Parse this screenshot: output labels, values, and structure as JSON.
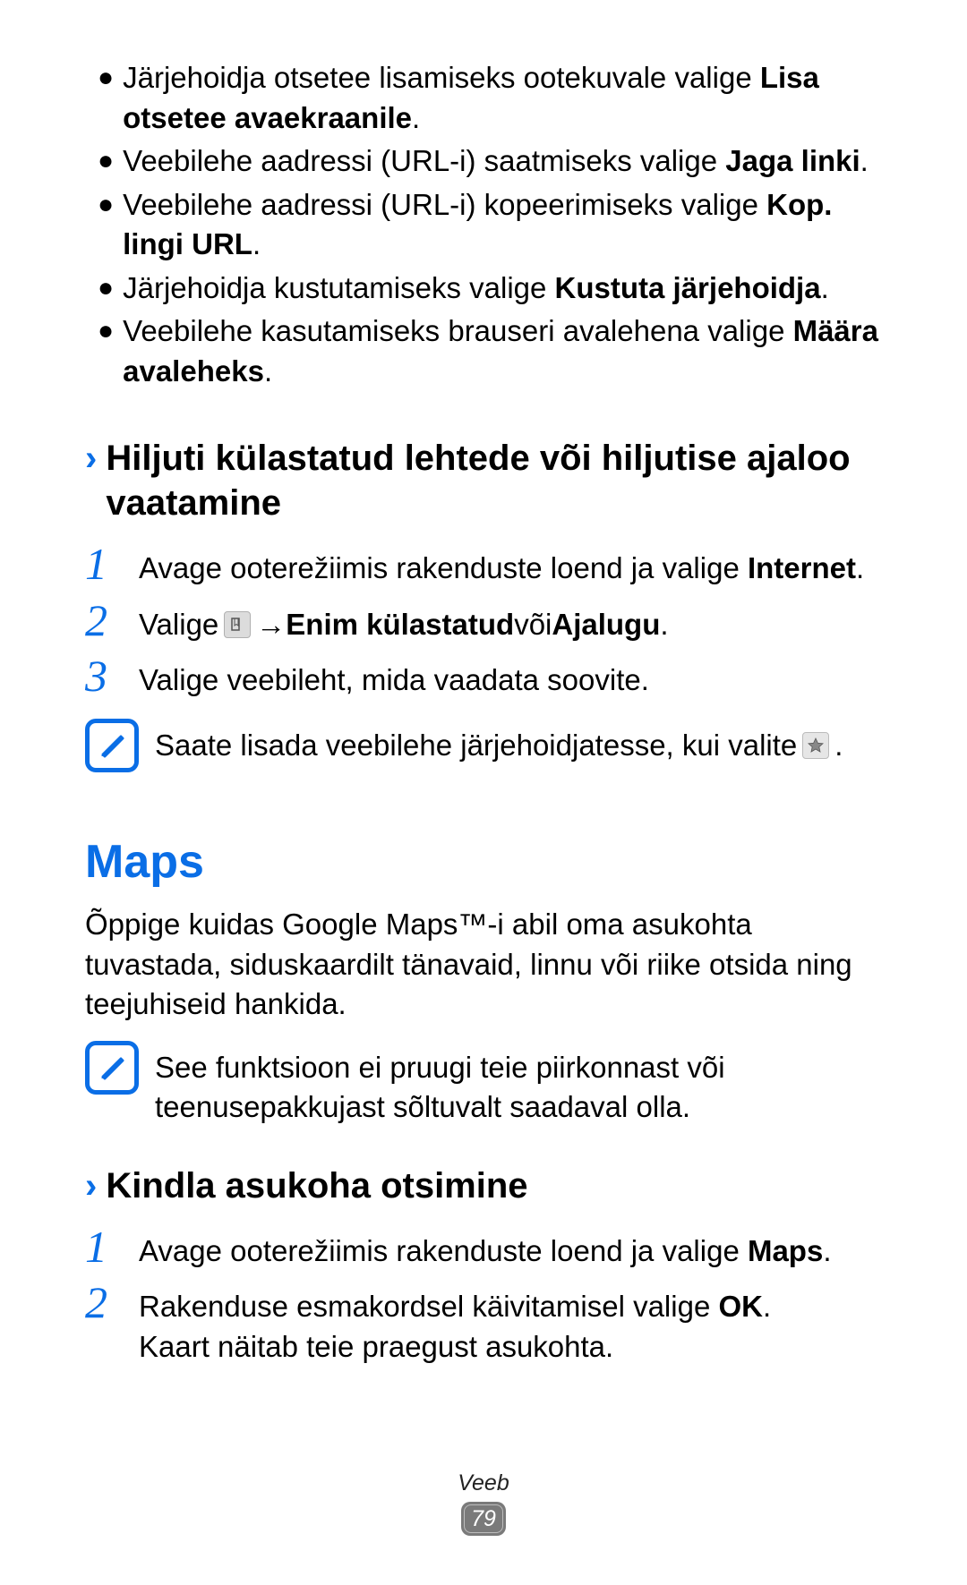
{
  "bullets": [
    {
      "pre": "Järjehoidja otsetee lisamiseks ootekuvale valige ",
      "bold": "Lisa otsetee avaekraanile",
      "post": "."
    },
    {
      "pre": "Veebilehe aadressi (URL-i) saatmiseks valige ",
      "bold": "Jaga linki",
      "post": "."
    },
    {
      "pre": "Veebilehe aadressi (URL-i) kopeerimiseks valige ",
      "bold": "Kop. lingi URL",
      "post": "."
    },
    {
      "pre": "Järjehoidja kustutamiseks valige ",
      "bold": "Kustuta järjehoidja",
      "post": "."
    },
    {
      "pre": "Veebilehe kasutamiseks brauseri avalehena valige ",
      "bold": "Määra avaleheks",
      "post": "."
    }
  ],
  "sub1": "Hiljuti külastatud lehtede või hiljutise ajaloo vaatamine",
  "steps1": {
    "s1_pre": "Avage ooterežiimis rakenduste loend ja valige ",
    "s1_bold": "Internet",
    "s1_post": ".",
    "s2_a": "Valige ",
    "s2_arrow": " → ",
    "s2_bold1": "Enim külastatud",
    "s2_mid": " või ",
    "s2_bold2": "Ajalugu",
    "s2_post": ".",
    "s3": "Valige veebileht, mida vaadata soovite."
  },
  "note1_pre": "Saate lisada veebilehe järjehoidjatesse, kui valite ",
  "note1_post": ".",
  "maps_title": "Maps",
  "maps_para": "Õppige kuidas Google Maps™-i abil oma asukohta tuvastada, siduskaardilt tänavaid, linnu või riike otsida ning teejuhiseid hankida.",
  "note2": "See funktsioon ei pruugi teie piirkonnast või teenusepakkujast sõltuvalt saadaval olla.",
  "sub2": "Kindla asukoha otsimine",
  "steps2": {
    "s1_pre": "Avage ooterežiimis rakenduste loend ja valige ",
    "s1_bold": "Maps",
    "s1_post": ".",
    "s2_pre": "Rakenduse esmakordsel käivitamisel valige ",
    "s2_bold": "OK",
    "s2_post": ".",
    "s2_line2": "Kaart näitab teie praegust asukohta."
  },
  "footer_label": "Veeb",
  "page_number": "79"
}
